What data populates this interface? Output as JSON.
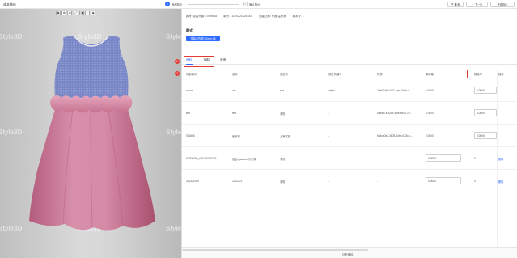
{
  "app": {
    "title": "成本核价"
  },
  "steps": [
    {
      "num": "1",
      "label": "面料核价"
    },
    {
      "num": "2",
      "label": "确认核价"
    }
  ],
  "actions": {
    "cancel": "取消",
    "next": "下一步",
    "finish": "完成核价"
  },
  "viewer": {
    "watermark": "Style3D",
    "tools": [
      "▣",
      "⊕",
      "⊖",
      "⤢",
      "◨",
      "◐",
      "◉"
    ]
  },
  "info": {
    "model": "款号: 童装外套 0.0mm.65",
    "style": "款号: LD-20221024-003",
    "date": "创建日期: 众鑫 温州港",
    "version": "版本号: 1"
  },
  "section": {
    "title": "款式",
    "pattern_chip": "童装连衣裙 0.0mm.65"
  },
  "tabs": [
    {
      "label": "面料",
      "active": true
    },
    {
      "label": "辅料",
      "active": false
    },
    {
      "label": "其他",
      "active": false
    }
  ],
  "badges": {
    "one": "1",
    "two": "2"
  },
  "table": {
    "headers": [
      "内部编号",
      "名称",
      "供应商",
      "供应商编号",
      "材质",
      "单用量",
      "损耗率",
      "操作"
    ],
    "rows": [
      {
        "id": "cotum",
        "name": "cat",
        "supplier": "sae",
        "supplier_no": "vatha",
        "material": "22ef2ad0-c027-4ae7-9a5c-0...",
        "usage": "0.0000",
        "loss": "0.0000",
        "op": ""
      },
      {
        "id": "test",
        "name": "test",
        "supplier": "未知",
        "supplier_no": "-",
        "material": "5ba5e74-82cb-4f6e-b44e-7b...",
        "usage": "0.0000",
        "loss": "0.0000",
        "op": ""
      },
      {
        "id": "006656",
        "name": "段织棉",
        "supplier": "上海富德",
        "supplier_no": "-",
        "material": "bd4ce0e2-3805-44be-b72b-c...",
        "usage": "0.0000",
        "loss": "0.0000",
        "op": ""
      },
      {
        "id": "K3000090_001100002746...",
        "name": "尼龙/spandex 针织棉",
        "supplier": "未知",
        "supplier_no": "-",
        "material": "-",
        "usage": "0.0000",
        "loss": "0",
        "op": "删除"
      },
      {
        "id": "321321000",
        "name": "2312321",
        "supplier": "未知",
        "supplier_no": "-",
        "material": "-",
        "usage": "0.0000",
        "loss": "0",
        "op": "删除"
      }
    ]
  },
  "footer": {
    "total": "补充面料"
  },
  "colors": {
    "accent": "#2f6bff",
    "highlight": "#e53935"
  }
}
